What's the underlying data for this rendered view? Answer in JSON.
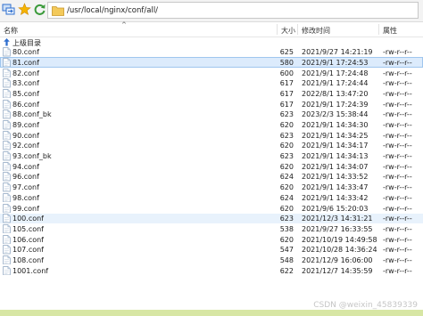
{
  "address": {
    "path": "/usr/local/nginx/conf/all/"
  },
  "columns": {
    "name": "名称",
    "size": "大小",
    "mtime": "修改时间",
    "perm": "属性"
  },
  "parent_label": "上级目录",
  "files": [
    {
      "name": "80.conf",
      "size": "625",
      "date": "2021/9/27 14:21:19",
      "perm": "-rw-r--r--"
    },
    {
      "name": "81.conf",
      "size": "580",
      "date": "2021/9/1 17:24:53",
      "perm": "-rw-r--r--"
    },
    {
      "name": "82.conf",
      "size": "600",
      "date": "2021/9/1 17:24:48",
      "perm": "-rw-r--r--"
    },
    {
      "name": "83.conf",
      "size": "617",
      "date": "2021/9/1 17:24:44",
      "perm": "-rw-r--r--"
    },
    {
      "name": "85.conf",
      "size": "617",
      "date": "2022/8/1 13:47:20",
      "perm": "-rw-r--r--"
    },
    {
      "name": "86.conf",
      "size": "617",
      "date": "2021/9/1 17:24:39",
      "perm": "-rw-r--r--"
    },
    {
      "name": "88.conf_bk",
      "size": "623",
      "date": "2023/2/3 15:38:44",
      "perm": "-rw-r--r--"
    },
    {
      "name": "89.conf",
      "size": "620",
      "date": "2021/9/1 14:34:30",
      "perm": "-rw-r--r--"
    },
    {
      "name": "90.conf",
      "size": "623",
      "date": "2021/9/1 14:34:25",
      "perm": "-rw-r--r--"
    },
    {
      "name": "92.conf",
      "size": "620",
      "date": "2021/9/1 14:34:17",
      "perm": "-rw-r--r--"
    },
    {
      "name": "93.conf_bk",
      "size": "623",
      "date": "2021/9/1 14:34:13",
      "perm": "-rw-r--r--"
    },
    {
      "name": "94.conf",
      "size": "620",
      "date": "2021/9/1 14:34:07",
      "perm": "-rw-r--r--"
    },
    {
      "name": "96.conf",
      "size": "624",
      "date": "2021/9/1 14:33:52",
      "perm": "-rw-r--r--"
    },
    {
      "name": "97.conf",
      "size": "620",
      "date": "2021/9/1 14:33:47",
      "perm": "-rw-r--r--"
    },
    {
      "name": "98.conf",
      "size": "624",
      "date": "2021/9/1 14:33:42",
      "perm": "-rw-r--r--"
    },
    {
      "name": "99.conf",
      "size": "620",
      "date": "2021/9/6 15:20:03",
      "perm": "-rw-r--r--"
    },
    {
      "name": "100.conf",
      "size": "623",
      "date": "2021/12/3 14:31:21",
      "perm": "-rw-r--r--"
    },
    {
      "name": "105.conf",
      "size": "538",
      "date": "2021/9/27 16:33:55",
      "perm": "-rw-r--r--"
    },
    {
      "name": "106.conf",
      "size": "620",
      "date": "2021/10/19 14:49:58",
      "perm": "-rw-r--r--"
    },
    {
      "name": "107.conf",
      "size": "547",
      "date": "2021/10/28 14:36:24",
      "perm": "-rw-r--r--"
    },
    {
      "name": "108.conf",
      "size": "548",
      "date": "2021/12/9 16:06:00",
      "perm": "-rw-r--r--"
    },
    {
      "name": "1001.conf",
      "size": "622",
      "date": "2021/12/7 14:35:59",
      "perm": "-rw-r--r--"
    }
  ],
  "states": {
    "selected_row": "81.conf",
    "highlighted_row": "100.conf"
  },
  "watermark": "CSDN @weixin_45839339",
  "colors": {
    "selection": "#dcebfc",
    "hover": "#e8f2fc",
    "bottom_bar": "#d7e6a4",
    "folder_icon": "#e8b640",
    "star_icon": "#f5b400",
    "refresh_icon": "#3a9a3a",
    "transfer_icon": "#2f6fcf"
  },
  "icons": {
    "transfer": "transfer-icon",
    "favorite": "star-icon",
    "refresh": "refresh-icon",
    "folder": "folder-icon",
    "parent": "up-arrow-icon",
    "file": "file-icon"
  }
}
